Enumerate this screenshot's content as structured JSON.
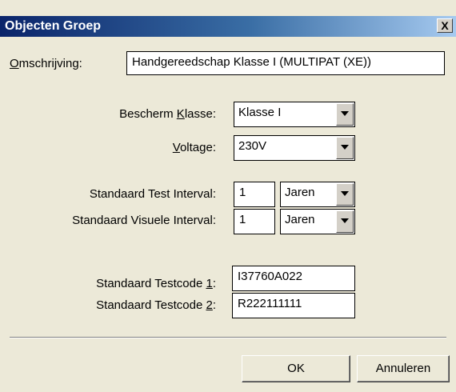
{
  "window": {
    "title": "Objecten Groep",
    "close_label": "X"
  },
  "omschrijving": {
    "label_first": "O",
    "label_rest": "mschrijving:",
    "value": "Handgereedschap Klasse I (MULTIPAT (XE))"
  },
  "bescherm_klasse": {
    "label_pre": "Bescherm ",
    "label_ul": "K",
    "label_post": "lasse:",
    "selected": "Klasse I"
  },
  "voltage": {
    "label_ul": "V",
    "label_rest": "oltage:",
    "selected": "230V"
  },
  "test_interval": {
    "label": "Standaard Test Interval:",
    "value": "1",
    "unit": "Jaren"
  },
  "visuele_interval": {
    "label": "Standaard Visuele Interval:",
    "value": "1",
    "unit": "Jaren"
  },
  "testcode1": {
    "label_pre": "Standaard Testcode ",
    "label_ul": "1",
    "label_post": ":",
    "value": "I37760A022"
  },
  "testcode2": {
    "label_pre": "Standaard Testcode ",
    "label_ul": "2",
    "label_post": ":",
    "value": "R222111111"
  },
  "buttons": {
    "ok": "OK",
    "cancel": "Annuleren"
  }
}
